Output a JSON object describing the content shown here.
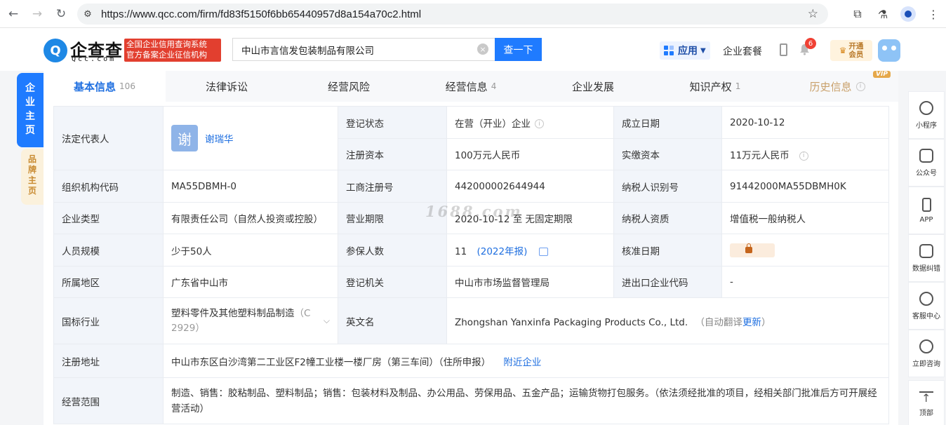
{
  "browser": {
    "url": "https://www.qcc.com/firm/fd83f5150f6bb65440957d8a154a70c2.html"
  },
  "header": {
    "logo_text": "企查查",
    "logo_sub": "Qcc.com",
    "badge_line1": "全国企业信用查询系统",
    "badge_line2": "官方备案企业征信机构",
    "search_value": "中山市言信发包装制品有限公司",
    "search_button": "查一下",
    "apps_label": "应用",
    "package_label": "企业套餐",
    "notification_count": "6",
    "vip_line1": "开通",
    "vip_line2": "会员"
  },
  "side_tabs": {
    "main": "企业主页",
    "brand": "品牌主页"
  },
  "tabs": [
    {
      "label": "基本信息",
      "count": "106"
    },
    {
      "label": "法律诉讼",
      "count": ""
    },
    {
      "label": "经营风险",
      "count": ""
    },
    {
      "label": "经营信息",
      "count": "4"
    },
    {
      "label": "企业发展",
      "count": ""
    },
    {
      "label": "知识产权",
      "count": "1"
    },
    {
      "label": "历史信息",
      "count": ""
    }
  ],
  "vip_tag": "VIP",
  "info": {
    "legal_rep_label": "法定代表人",
    "legal_rep_avatar": "谢",
    "legal_rep_name": "谢瑞华",
    "reg_status_label": "登记状态",
    "reg_status": "在营（开业）企业",
    "found_date_label": "成立日期",
    "found_date": "2020-10-12",
    "reg_capital_label": "注册资本",
    "reg_capital": "100万元人民币",
    "paid_capital_label": "实缴资本",
    "paid_capital": "11万元人民币",
    "org_code_label": "组织机构代码",
    "org_code": "MA55DBMH-0",
    "biz_reg_no_label": "工商注册号",
    "biz_reg_no": "442000002644944",
    "taxpayer_id_label": "纳税人识别号",
    "taxpayer_id": "91442000MA55DBMH0K",
    "company_type_label": "企业类型",
    "company_type": "有限责任公司（自然人投资或控股）",
    "biz_term_label": "营业期限",
    "biz_term": "2020-10-12 至 无固定期限",
    "taxpayer_qual_label": "纳税人资质",
    "taxpayer_qual": "增值税一般纳税人",
    "staff_size_label": "人员规模",
    "staff_size": "少于50人",
    "insured_label": "参保人数",
    "insured": "11",
    "insured_year": "(2022年报)",
    "approval_date_label": "核准日期",
    "region_label": "所属地区",
    "region": "广东省中山市",
    "reg_authority_label": "登记机关",
    "reg_authority": "中山市市场监督管理局",
    "import_export_label": "进出口企业代码",
    "import_export": "-",
    "industry_label": "国标行业",
    "industry": "塑料零件及其他塑料制品制造",
    "industry_code": "（C 2929）",
    "english_name_label": "英文名",
    "english_name": "Zhongshan Yanxinfa Packaging Products Co., Ltd.",
    "english_name_note": "（自动翻译",
    "english_name_update": "更新",
    "english_name_close": "）",
    "address_label": "注册地址",
    "address": "中山市东区白沙湾第二工业区F2幢工业楼一楼厂房（第三车间）（住所申报）",
    "nearby_link": "附近企业",
    "scope_label": "经营范围",
    "scope": "制造、销售：胶粘制品、塑料制品；销售：包装材料及制品、办公用品、劳保用品、五金产品；运输货物打包服务。（依法须经批准的项目，经相关部门批准后方可开展经营活动）"
  },
  "watermark": "1688.com",
  "right_tools": [
    {
      "label": "小程序",
      "icon": "mini-program-icon"
    },
    {
      "label": "公众号",
      "icon": "official-account-icon"
    },
    {
      "label": "APP",
      "icon": "phone-app-icon"
    },
    {
      "label": "数据纠错",
      "icon": "data-correction-icon"
    },
    {
      "label": "客服中心",
      "icon": "customer-service-icon"
    },
    {
      "label": "立即咨询",
      "icon": "chat-icon"
    },
    {
      "label": "顶部",
      "icon": "back-to-top-icon"
    }
  ]
}
